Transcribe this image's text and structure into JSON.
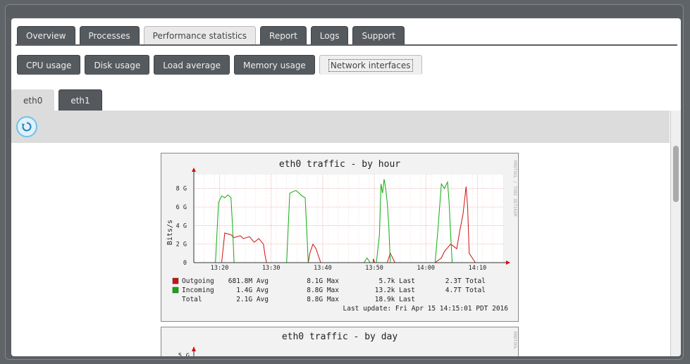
{
  "main_tabs": [
    "Overview",
    "Processes",
    "Performance statistics",
    "Report",
    "Logs",
    "Support"
  ],
  "sub_tabs": [
    "CPU usage",
    "Disk usage",
    "Load average",
    "Memory usage",
    "Network interfaces"
  ],
  "iface_tabs": [
    "eth0",
    "eth1"
  ],
  "graph1": {
    "title": "eth0 traffic - by hour",
    "side_label": "RRDTOOL / TOBI OETIKER",
    "ylabel": "Bits/s",
    "legend": [
      {
        "label": "Outgoing",
        "avg": "681.8M Avg",
        "max": "8.1G Max",
        "last": "5.7k Last",
        "total": "2.3T Total",
        "color": "#cc1111"
      },
      {
        "label": "Incoming",
        "avg": "1.4G Avg",
        "max": "8.8G Max",
        "last": "13.2k Last",
        "total": "4.7T Total",
        "color": "#11aa11"
      },
      {
        "label": "Total",
        "avg": "2.1G Avg",
        "max": "8.8G Max",
        "last": "18.9k Last",
        "total": ""
      }
    ],
    "last_update": "Last update: Fri Apr 15 14:15:01 PDT 2016"
  },
  "graph2": {
    "title": "eth0 traffic - by day",
    "side_label": "RRDTOOL",
    "first_tick": "5 G"
  },
  "chart_data": {
    "type": "line",
    "title": "eth0 traffic - by hour",
    "ylabel": "Bits/s",
    "x_ticks": [
      "13:20",
      "13:30",
      "13:40",
      "13:50",
      "14:00",
      "14:10"
    ],
    "y_ticks": [
      "0",
      "2 G",
      "4 G",
      "6 G",
      "8 G"
    ],
    "xlim": [
      13.25,
      14.25
    ],
    "ylim": [
      0,
      9.5
    ],
    "series": [
      {
        "name": "Outgoing",
        "color": "#cc1111",
        "points": [
          [
            13.32,
            0
          ],
          [
            13.34,
            0
          ],
          [
            13.35,
            3.2
          ],
          [
            13.37,
            3.0
          ],
          [
            13.38,
            2.7
          ],
          [
            13.4,
            2.9
          ],
          [
            13.41,
            2.6
          ],
          [
            13.43,
            2.8
          ],
          [
            13.445,
            2.2
          ],
          [
            13.46,
            2.6
          ],
          [
            13.475,
            2.0
          ],
          [
            13.48,
            0.8
          ],
          [
            13.485,
            0
          ],
          [
            13.62,
            0
          ],
          [
            13.625,
            1.0
          ],
          [
            13.635,
            2.0
          ],
          [
            13.645,
            1.5
          ],
          [
            13.655,
            0.5
          ],
          [
            13.66,
            0
          ],
          [
            13.8,
            0
          ],
          [
            13.83,
            0
          ],
          [
            13.83,
            0.4
          ],
          [
            13.835,
            0
          ],
          [
            13.875,
            0
          ],
          [
            13.885,
            1.0
          ],
          [
            13.9,
            0
          ],
          [
            14.03,
            0
          ],
          [
            14.05,
            0.5
          ],
          [
            14.06,
            1.2
          ],
          [
            14.08,
            2.0
          ],
          [
            14.1,
            1.5
          ],
          [
            14.11,
            3.5
          ],
          [
            14.12,
            5.2
          ],
          [
            14.13,
            8.2
          ],
          [
            14.135,
            6.0
          ],
          [
            14.14,
            1.0
          ],
          [
            14.15,
            0.5
          ],
          [
            14.16,
            0
          ]
        ]
      },
      {
        "name": "Incoming",
        "color": "#11aa11",
        "points": [
          [
            13.3,
            0
          ],
          [
            13.32,
            0
          ],
          [
            13.33,
            6.5
          ],
          [
            13.34,
            7.2
          ],
          [
            13.35,
            7.0
          ],
          [
            13.36,
            7.3
          ],
          [
            13.37,
            7.0
          ],
          [
            13.375,
            4.0
          ],
          [
            13.38,
            0
          ],
          [
            13.53,
            0
          ],
          [
            13.55,
            0
          ],
          [
            13.56,
            7.5
          ],
          [
            13.58,
            7.8
          ],
          [
            13.59,
            7.5
          ],
          [
            13.6,
            7.2
          ],
          [
            13.61,
            7.0
          ],
          [
            13.615,
            3.5
          ],
          [
            13.62,
            0
          ],
          [
            13.7,
            0
          ],
          [
            13.75,
            0
          ],
          [
            13.8,
            0
          ],
          [
            13.81,
            0.5
          ],
          [
            13.82,
            0
          ],
          [
            13.84,
            0
          ],
          [
            13.85,
            3.0
          ],
          [
            13.855,
            8.5
          ],
          [
            13.86,
            7.5
          ],
          [
            13.865,
            9.0
          ],
          [
            13.87,
            8.0
          ],
          [
            13.875,
            6.5
          ],
          [
            13.88,
            4.0
          ],
          [
            13.885,
            0
          ],
          [
            14.03,
            0
          ],
          [
            14.04,
            4.0
          ],
          [
            14.05,
            8.5
          ],
          [
            14.06,
            8.0
          ],
          [
            14.07,
            8.7
          ],
          [
            14.075,
            6.5
          ],
          [
            14.08,
            3.0
          ],
          [
            14.085,
            0
          ]
        ]
      }
    ]
  }
}
